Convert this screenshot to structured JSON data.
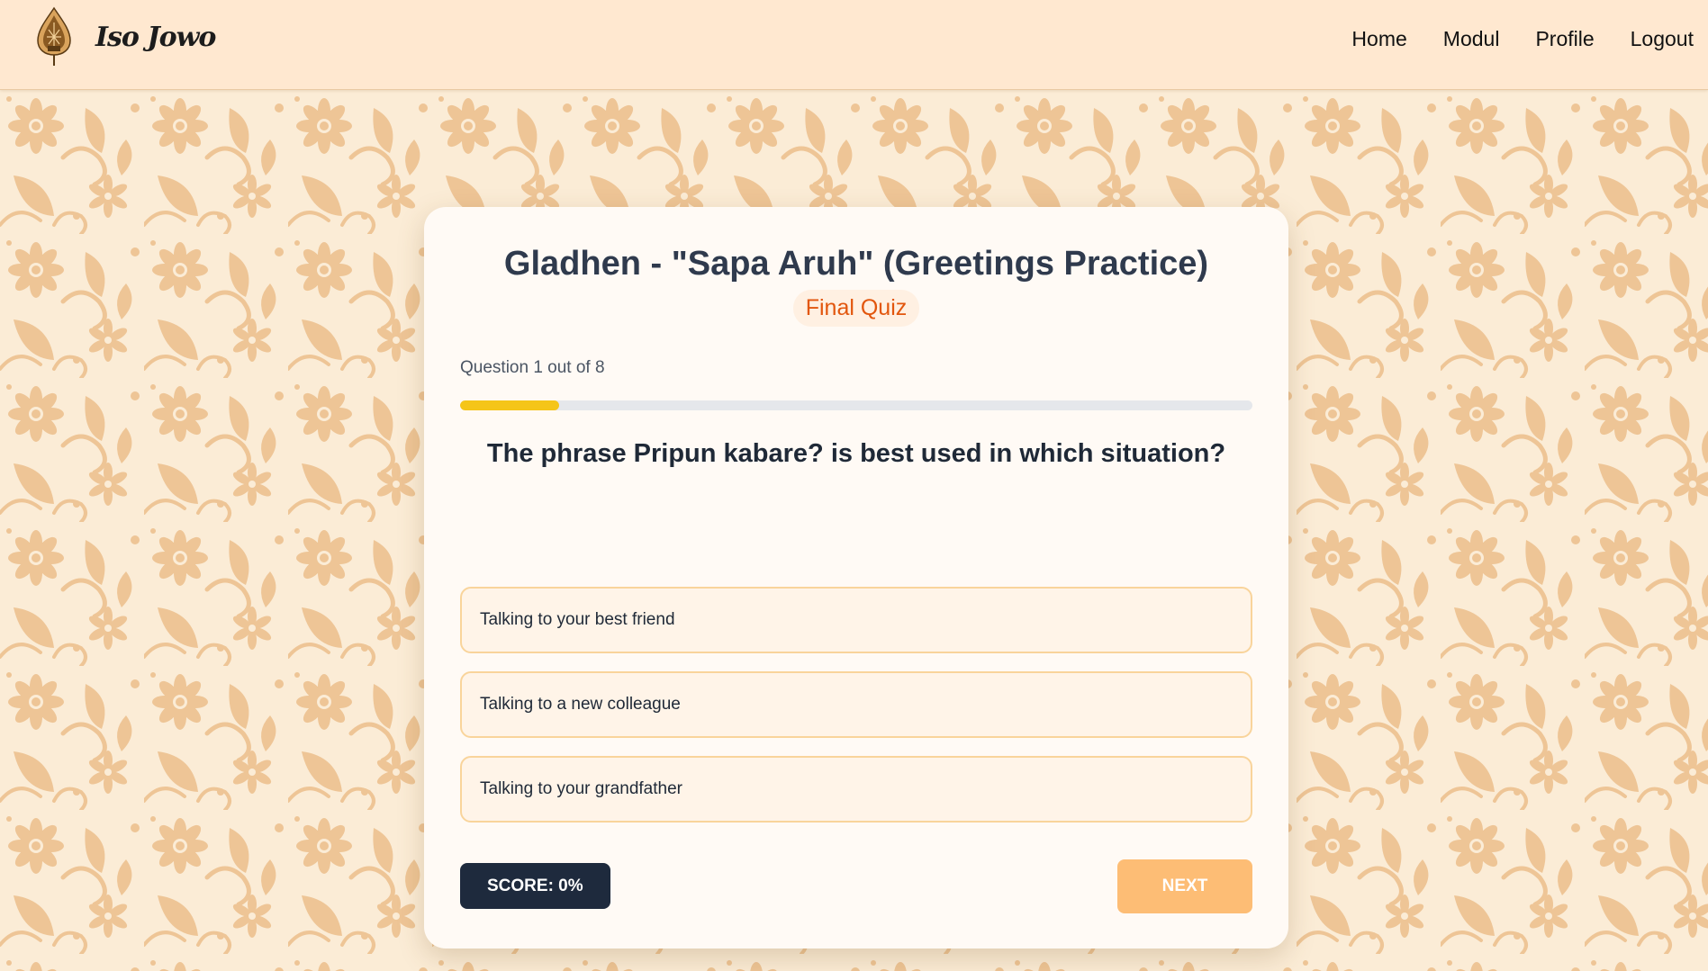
{
  "header": {
    "brand_name": "Iso Jowo",
    "logo_icon": "gunungan-wayang-icon",
    "nav": [
      {
        "label": "Home"
      },
      {
        "label": "Modul"
      },
      {
        "label": "Profile"
      },
      {
        "label": "Logout"
      }
    ]
  },
  "quiz": {
    "title": "Gladhen - \"Sapa Aruh\" (Greetings Practice)",
    "subtitle": "Final Quiz",
    "question_counter": "Question 1 out of 8",
    "current_question": 1,
    "total_questions": 8,
    "progress_fraction": 0.125,
    "question": "The phrase Pripun kabare? is best used in which situation?",
    "options": [
      {
        "label": "Talking to your best friend"
      },
      {
        "label": "Talking to a new colleague"
      },
      {
        "label": "Talking to your grandfather"
      }
    ],
    "score_label": "SCORE: 0%",
    "next_label": "NEXT"
  },
  "colors": {
    "header_bg": "#ffe8d0",
    "card_bg": "#fffaf5",
    "subtitle_accent": "#e2560d",
    "progress_fill": "#f5c518",
    "option_bg": "#fff4e8",
    "option_border": "#f9d49b",
    "score_bg": "#1e2a3d",
    "next_bg": "#fdbd75",
    "pattern_bg": "#fbecd6",
    "pattern_motif": "#eec596"
  }
}
